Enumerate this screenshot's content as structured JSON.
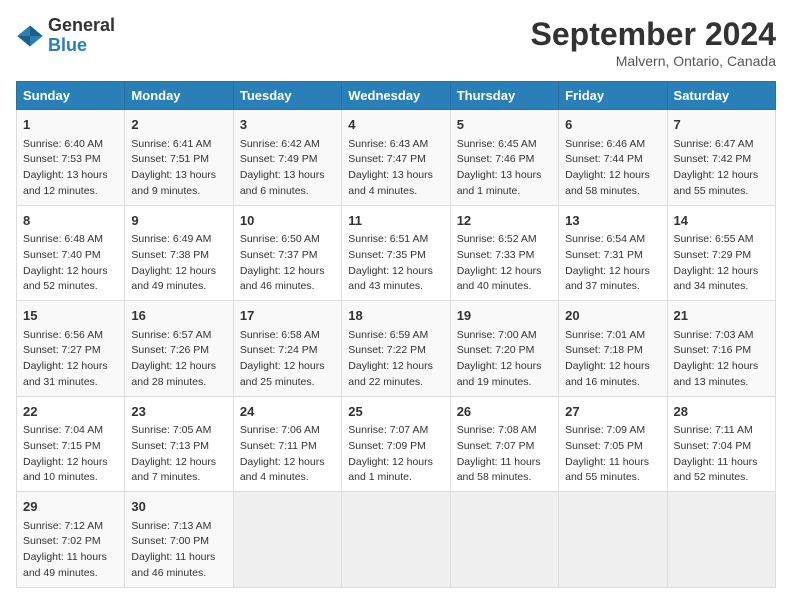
{
  "header": {
    "logo_general": "General",
    "logo_blue": "Blue",
    "month": "September 2024",
    "location": "Malvern, Ontario, Canada"
  },
  "columns": [
    "Sunday",
    "Monday",
    "Tuesday",
    "Wednesday",
    "Thursday",
    "Friday",
    "Saturday"
  ],
  "weeks": [
    [
      {
        "day": "1",
        "info": "Sunrise: 6:40 AM\nSunset: 7:53 PM\nDaylight: 13 hours and 12 minutes."
      },
      {
        "day": "2",
        "info": "Sunrise: 6:41 AM\nSunset: 7:51 PM\nDaylight: 13 hours and 9 minutes."
      },
      {
        "day": "3",
        "info": "Sunrise: 6:42 AM\nSunset: 7:49 PM\nDaylight: 13 hours and 6 minutes."
      },
      {
        "day": "4",
        "info": "Sunrise: 6:43 AM\nSunset: 7:47 PM\nDaylight: 13 hours and 4 minutes."
      },
      {
        "day": "5",
        "info": "Sunrise: 6:45 AM\nSunset: 7:46 PM\nDaylight: 13 hours and 1 minute."
      },
      {
        "day": "6",
        "info": "Sunrise: 6:46 AM\nSunset: 7:44 PM\nDaylight: 12 hours and 58 minutes."
      },
      {
        "day": "7",
        "info": "Sunrise: 6:47 AM\nSunset: 7:42 PM\nDaylight: 12 hours and 55 minutes."
      }
    ],
    [
      {
        "day": "8",
        "info": "Sunrise: 6:48 AM\nSunset: 7:40 PM\nDaylight: 12 hours and 52 minutes."
      },
      {
        "day": "9",
        "info": "Sunrise: 6:49 AM\nSunset: 7:38 PM\nDaylight: 12 hours and 49 minutes."
      },
      {
        "day": "10",
        "info": "Sunrise: 6:50 AM\nSunset: 7:37 PM\nDaylight: 12 hours and 46 minutes."
      },
      {
        "day": "11",
        "info": "Sunrise: 6:51 AM\nSunset: 7:35 PM\nDaylight: 12 hours and 43 minutes."
      },
      {
        "day": "12",
        "info": "Sunrise: 6:52 AM\nSunset: 7:33 PM\nDaylight: 12 hours and 40 minutes."
      },
      {
        "day": "13",
        "info": "Sunrise: 6:54 AM\nSunset: 7:31 PM\nDaylight: 12 hours and 37 minutes."
      },
      {
        "day": "14",
        "info": "Sunrise: 6:55 AM\nSunset: 7:29 PM\nDaylight: 12 hours and 34 minutes."
      }
    ],
    [
      {
        "day": "15",
        "info": "Sunrise: 6:56 AM\nSunset: 7:27 PM\nDaylight: 12 hours and 31 minutes."
      },
      {
        "day": "16",
        "info": "Sunrise: 6:57 AM\nSunset: 7:26 PM\nDaylight: 12 hours and 28 minutes."
      },
      {
        "day": "17",
        "info": "Sunrise: 6:58 AM\nSunset: 7:24 PM\nDaylight: 12 hours and 25 minutes."
      },
      {
        "day": "18",
        "info": "Sunrise: 6:59 AM\nSunset: 7:22 PM\nDaylight: 12 hours and 22 minutes."
      },
      {
        "day": "19",
        "info": "Sunrise: 7:00 AM\nSunset: 7:20 PM\nDaylight: 12 hours and 19 minutes."
      },
      {
        "day": "20",
        "info": "Sunrise: 7:01 AM\nSunset: 7:18 PM\nDaylight: 12 hours and 16 minutes."
      },
      {
        "day": "21",
        "info": "Sunrise: 7:03 AM\nSunset: 7:16 PM\nDaylight: 12 hours and 13 minutes."
      }
    ],
    [
      {
        "day": "22",
        "info": "Sunrise: 7:04 AM\nSunset: 7:15 PM\nDaylight: 12 hours and 10 minutes."
      },
      {
        "day": "23",
        "info": "Sunrise: 7:05 AM\nSunset: 7:13 PM\nDaylight: 12 hours and 7 minutes."
      },
      {
        "day": "24",
        "info": "Sunrise: 7:06 AM\nSunset: 7:11 PM\nDaylight: 12 hours and 4 minutes."
      },
      {
        "day": "25",
        "info": "Sunrise: 7:07 AM\nSunset: 7:09 PM\nDaylight: 12 hours and 1 minute."
      },
      {
        "day": "26",
        "info": "Sunrise: 7:08 AM\nSunset: 7:07 PM\nDaylight: 11 hours and 58 minutes."
      },
      {
        "day": "27",
        "info": "Sunrise: 7:09 AM\nSunset: 7:05 PM\nDaylight: 11 hours and 55 minutes."
      },
      {
        "day": "28",
        "info": "Sunrise: 7:11 AM\nSunset: 7:04 PM\nDaylight: 11 hours and 52 minutes."
      }
    ],
    [
      {
        "day": "29",
        "info": "Sunrise: 7:12 AM\nSunset: 7:02 PM\nDaylight: 11 hours and 49 minutes."
      },
      {
        "day": "30",
        "info": "Sunrise: 7:13 AM\nSunset: 7:00 PM\nDaylight: 11 hours and 46 minutes."
      },
      {
        "day": "",
        "info": ""
      },
      {
        "day": "",
        "info": ""
      },
      {
        "day": "",
        "info": ""
      },
      {
        "day": "",
        "info": ""
      },
      {
        "day": "",
        "info": ""
      }
    ]
  ]
}
